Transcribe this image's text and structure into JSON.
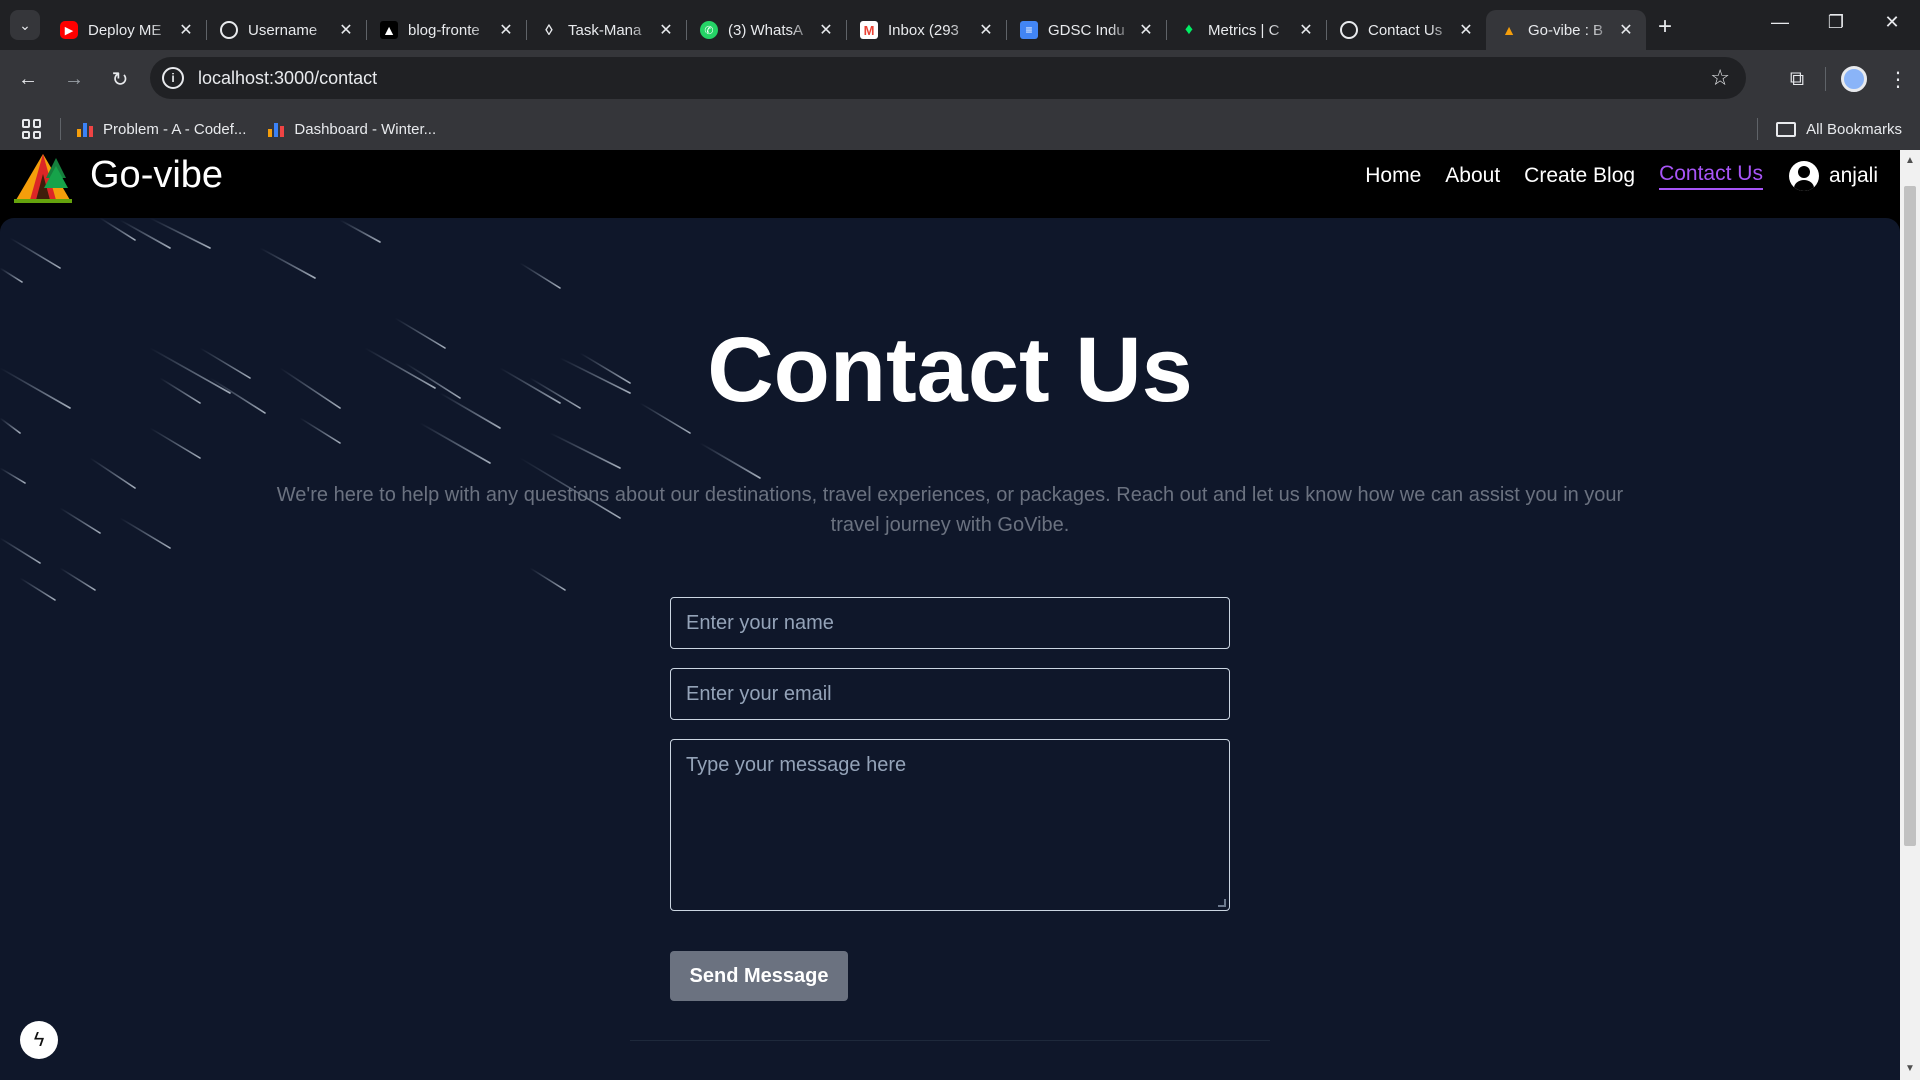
{
  "browser": {
    "tabs": [
      {
        "title": "Deploy ME",
        "favicon": "youtube-icon",
        "color": "#ff0000"
      },
      {
        "title": "Username",
        "favicon": "openai-icon",
        "color": "#9aa0a6"
      },
      {
        "title": "blog-fronte",
        "favicon": "vercel-icon",
        "color": "#ffffff"
      },
      {
        "title": "Task-Mana",
        "favicon": "render-icon",
        "color": "#ffffff"
      },
      {
        "title": "(3) WhatsA",
        "favicon": "whatsapp-icon",
        "color": "#25d366"
      },
      {
        "title": "Inbox (293",
        "favicon": "gmail-icon",
        "color": "#ea4335"
      },
      {
        "title": "GDSC Indu",
        "favicon": "docs-icon",
        "color": "#4285f4"
      },
      {
        "title": "Metrics | C",
        "favicon": "mongodb-icon",
        "color": "#00ed64"
      },
      {
        "title": "Contact Us",
        "favicon": "openai-icon",
        "color": "#9aa0a6"
      },
      {
        "title": "Go-vibe : B",
        "favicon": "tent-icon",
        "color": "#f59e0b",
        "active": true
      }
    ],
    "url": "localhost:3000/contact",
    "bookmarks": [
      {
        "label": "Problem - A - Codef..."
      },
      {
        "label": "Dashboard - Winter..."
      }
    ],
    "all_bookmarks_label": "All Bookmarks"
  },
  "site": {
    "brand": "Go-vibe",
    "nav": {
      "home": "Home",
      "about": "About",
      "create_blog": "Create Blog",
      "contact": "Contact Us",
      "user": "anjali"
    },
    "accent_color": "#a855f7",
    "background_color": "#0f172a"
  },
  "contact": {
    "title": "Contact Us",
    "description": "We're here to help with any questions about our destinations, travel experiences, or packages. Reach out and let us know how we can assist you in your travel journey with GoVibe.",
    "name_placeholder": "Enter your name",
    "email_placeholder": "Enter your email",
    "message_placeholder": "Type your message here",
    "submit_label": "Send Message"
  }
}
